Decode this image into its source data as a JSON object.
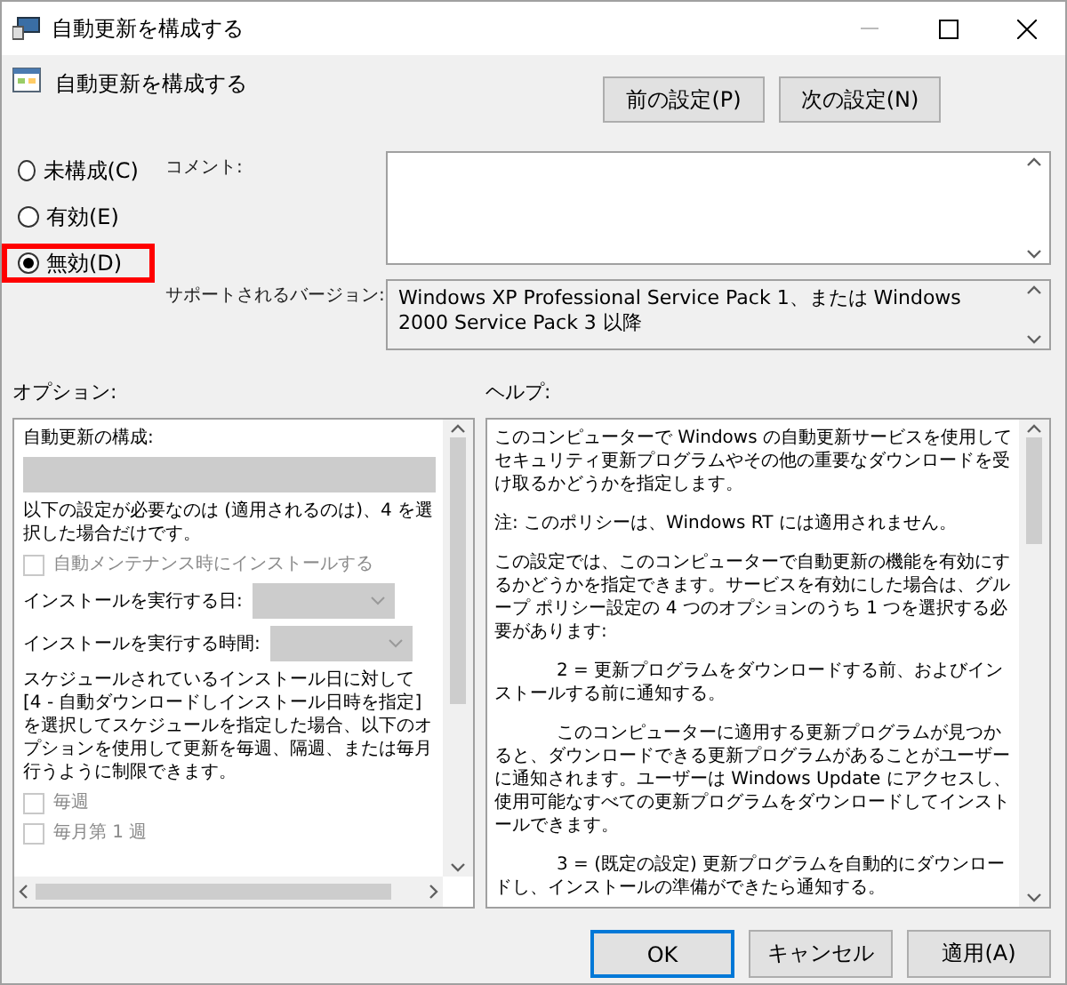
{
  "window": {
    "title": "自動更新を構成する"
  },
  "header": {
    "title": "自動更新を構成する"
  },
  "nav_buttons": [
    "前の設定(P)",
    "次の設定(N)"
  ],
  "state_options": [
    {
      "label": "未構成(C)",
      "selected": false,
      "highlighted": false
    },
    {
      "label": "有効(E)",
      "selected": false,
      "highlighted": false
    },
    {
      "label": "無効(D)",
      "selected": true,
      "highlighted": true
    }
  ],
  "comment": {
    "label": "コメント:"
  },
  "supported": {
    "label": "サポートされるバージョン:",
    "value": "Windows XP Professional Service Pack 1、または Windows 2000 Service Pack 3 以降"
  },
  "options": {
    "label": "オプション:",
    "items": [
      {
        "kind": "heading",
        "text": "自動更新の構成:"
      },
      {
        "kind": "select",
        "disabled": true
      },
      {
        "kind": "text",
        "text": "以下の設定が必要なのは (適用されるのは)、4 を選択した場合だけです。"
      },
      {
        "kind": "checkbox",
        "label": "自動メンテナンス時にインストールする",
        "checked": false,
        "disabled": true
      },
      {
        "kind": "labeled_select",
        "label": "インストールを実行する日:",
        "disabled": true
      },
      {
        "kind": "labeled_select",
        "label": "インストールを実行する時間:",
        "disabled": true
      },
      {
        "kind": "text",
        "text": "スケジュールされているインストール日に対して [4 - 自動ダウンロードしインストール日時を指定] を選択してスケジュールを指定した場合、以下のオプションを使用して更新を毎週、隔週、または毎月行うように制限できます。"
      },
      {
        "kind": "checkbox",
        "label": "毎週",
        "checked": false,
        "disabled": true
      },
      {
        "kind": "checkbox",
        "label": "毎月第 1 週",
        "checked": false,
        "disabled": true
      }
    ]
  },
  "help": {
    "label": "ヘルプ:",
    "paragraphs": [
      {
        "text": "このコンピューターで Windows の自動更新サービスを使用してセキュリティ更新プログラムやその他の重要なダウンロードを受け取るかどうかを指定します。",
        "indent": false
      },
      {
        "text": "注: このポリシーは、Windows RT には適用されません。",
        "indent": false
      },
      {
        "text": "この設定では、このコンピューターで自動更新の機能を有効にするかどうかを指定できます。サービスを有効にした場合は、グループ ポリシー設定の 4 つのオプションのうち 1 つを選択する必要があります:",
        "indent": false
      },
      {
        "text": "2 = 更新プログラムをダウンロードする前、およびインストールする前に通知する。",
        "indent": true
      },
      {
        "text": "このコンピューターに適用する更新プログラムが見つかると、ダウンロードできる更新プログラムがあることがユーザーに通知されます。ユーザーは Windows Update にアクセスし、使用可能なすべての更新プログラムをダウンロードしてインストールできます。",
        "indent": true
      },
      {
        "text": "3 = (既定の設定) 更新プログラムを自動的にダウンロードし、インストールの準備ができたら通知する。",
        "indent": true
      }
    ]
  },
  "buttons": [
    {
      "label": "OK",
      "default": true
    },
    {
      "label": "キャンセル",
      "default": false
    },
    {
      "label": "適用(A)",
      "default": false
    }
  ]
}
